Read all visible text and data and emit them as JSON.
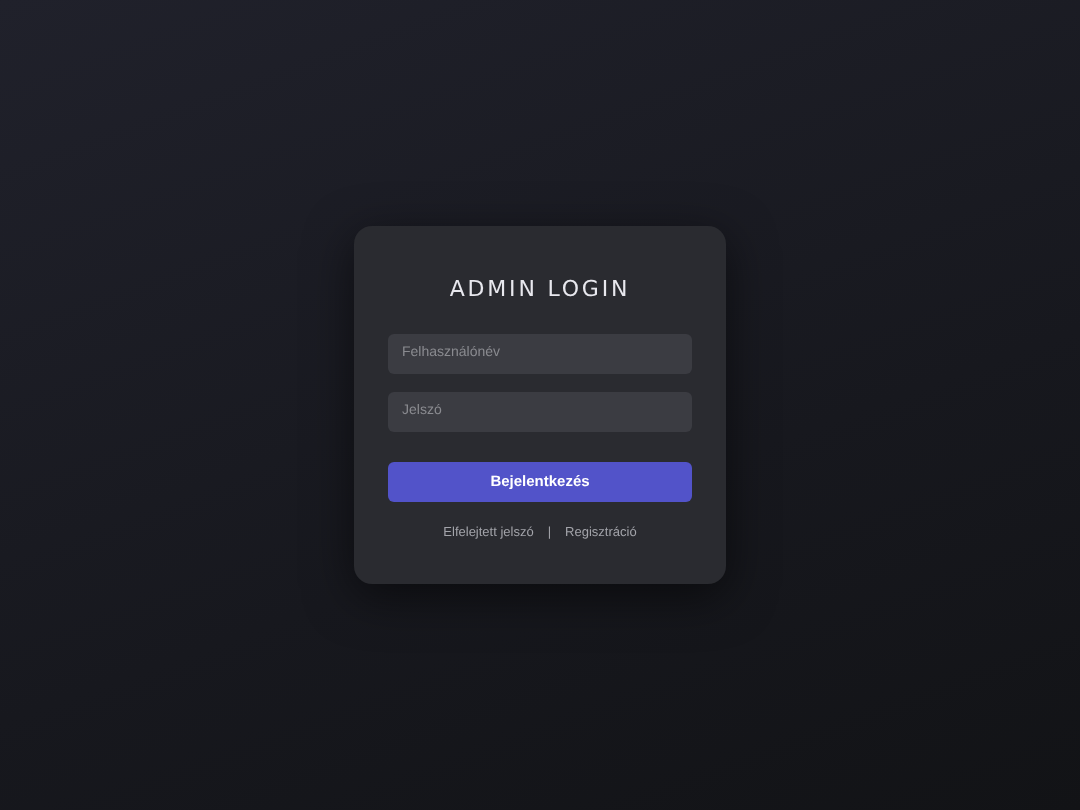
{
  "title": "ADMIN LOGIN",
  "fields": [
    {
      "placeholder": "Felhasználónév"
    },
    {
      "placeholder": "Jelszó"
    }
  ],
  "button": "Bejelentkezés",
  "links": [
    "Elfelejtett jelszó",
    "Regisztráció"
  ],
  "separator": "|"
}
